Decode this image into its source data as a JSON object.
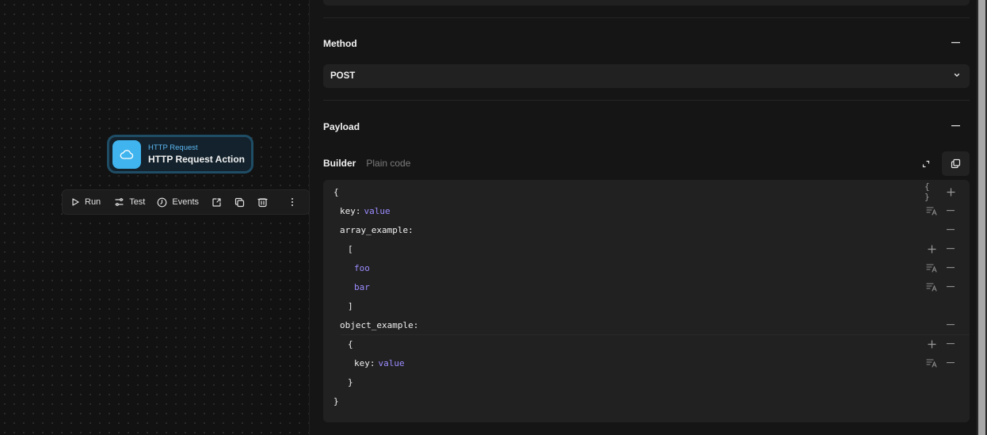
{
  "node": {
    "type_label": "HTTP Request",
    "name": "HTTP Request Action",
    "icon": "cloud-icon"
  },
  "toolbar": {
    "run_label": "Run",
    "test_label": "Test",
    "events_label": "Events",
    "icons": [
      "play-icon",
      "test-icon",
      "events-icon",
      "export-icon",
      "duplicate-icon",
      "trash-icon",
      "more-icon"
    ]
  },
  "panel": {
    "method": {
      "title": "Method",
      "value": "POST"
    },
    "payload": {
      "title": "Payload",
      "tabs": [
        {
          "label": "Builder",
          "active": true
        },
        {
          "label": "Plain code",
          "active": false
        }
      ],
      "lines": [
        {
          "text": "{",
          "indent": 0,
          "kind": "punc",
          "actions": [
            "braces",
            "add"
          ]
        },
        {
          "key": "key",
          "value": "value",
          "indent": 1,
          "kind": "pair",
          "actions": [
            "format",
            "remove"
          ]
        },
        {
          "key": "array_example",
          "indent": 1,
          "kind": "keyonly",
          "actions": [
            "remove"
          ]
        },
        {
          "text": "[",
          "indent": 2,
          "kind": "punc",
          "actions": [
            "add",
            "remove"
          ]
        },
        {
          "value": "foo",
          "indent": 3,
          "kind": "value",
          "actions": [
            "format",
            "remove"
          ]
        },
        {
          "value": "bar",
          "indent": 3,
          "kind": "value",
          "actions": [
            "format",
            "remove"
          ]
        },
        {
          "text": "]",
          "indent": 2,
          "kind": "punc",
          "actions": []
        },
        {
          "key": "object_example",
          "indent": 1,
          "kind": "keyonly",
          "actions": [
            "remove"
          ]
        },
        {
          "text": "{",
          "indent": 2,
          "kind": "punc",
          "actions": [
            "add",
            "remove"
          ]
        },
        {
          "key": "key",
          "value": "value",
          "indent": 3,
          "kind": "pair",
          "actions": [
            "format",
            "remove"
          ]
        },
        {
          "text": "}",
          "indent": 2,
          "kind": "punc",
          "actions": []
        },
        {
          "text": "}",
          "indent": 0,
          "kind": "punc",
          "actions": []
        }
      ]
    }
  },
  "colors": {
    "accent": "#3fb4ee",
    "value_text": "#9b8cff",
    "background": "#121212",
    "panel": "#151515"
  }
}
